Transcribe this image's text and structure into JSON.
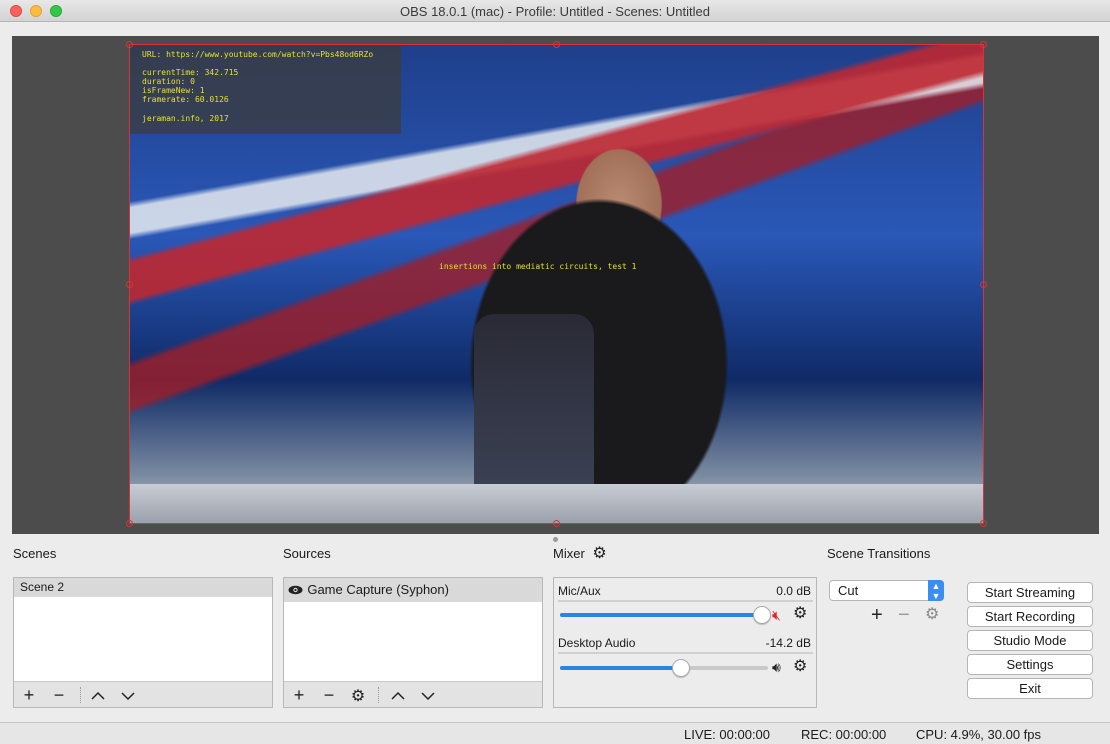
{
  "window": {
    "title": "OBS 18.0.1 (mac) - Profile: Untitled - Scenes: Untitled"
  },
  "preview": {
    "overlay_lines": [
      "URL: https://www.youtube.com/watch?v=Pbs48od6RZo",
      "currentTime: 342.715",
      "duration: 0",
      "isFrameNew: 1",
      "framerate: 60.0126",
      "jeraman.info, 2017"
    ],
    "caption": "insertions into mediatic circuits, test 1"
  },
  "scenes": {
    "title": "Scenes",
    "items": [
      "Scene 2"
    ],
    "selected_index": 0
  },
  "sources": {
    "title": "Sources",
    "items": [
      {
        "name": "Game Capture (Syphon)",
        "visible_icon": "eye-icon"
      }
    ]
  },
  "mixer": {
    "title": "Mixer",
    "channels": [
      {
        "name": "Mic/Aux",
        "db": "0.0 dB",
        "volume_fraction": 0.97,
        "muted": true,
        "speaker_icon": "speaker-muted-icon"
      },
      {
        "name": "Desktop Audio",
        "db": "-14.2 dB",
        "volume_fraction": 0.58,
        "muted": false,
        "speaker_icon": "speaker-icon"
      }
    ]
  },
  "transitions": {
    "title": "Scene Transitions",
    "selected": "Cut"
  },
  "controls": {
    "start_streaming": "Start Streaming",
    "start_recording": "Start Recording",
    "studio_mode": "Studio Mode",
    "settings": "Settings",
    "exit": "Exit"
  },
  "status": {
    "live": "LIVE: 00:00:00",
    "rec": "REC: 00:00:00",
    "cpu": "CPU: 4.9%, 30.00 fps"
  },
  "colors": {
    "selection_frame": "#d8333a",
    "slider_fill": "#2a85e0",
    "overlay_text": "#e6e033",
    "mute_red": "#e0242a"
  }
}
